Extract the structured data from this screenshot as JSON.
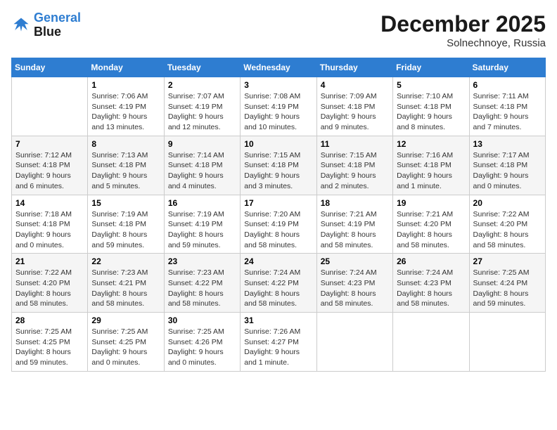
{
  "header": {
    "logo_line1": "General",
    "logo_line2": "Blue",
    "month": "December 2025",
    "location": "Solnechnoye, Russia"
  },
  "weekdays": [
    "Sunday",
    "Monday",
    "Tuesday",
    "Wednesday",
    "Thursday",
    "Friday",
    "Saturday"
  ],
  "weeks": [
    [
      {
        "day": "",
        "info": ""
      },
      {
        "day": "1",
        "info": "Sunrise: 7:06 AM\nSunset: 4:19 PM\nDaylight: 9 hours\nand 13 minutes."
      },
      {
        "day": "2",
        "info": "Sunrise: 7:07 AM\nSunset: 4:19 PM\nDaylight: 9 hours\nand 12 minutes."
      },
      {
        "day": "3",
        "info": "Sunrise: 7:08 AM\nSunset: 4:19 PM\nDaylight: 9 hours\nand 10 minutes."
      },
      {
        "day": "4",
        "info": "Sunrise: 7:09 AM\nSunset: 4:18 PM\nDaylight: 9 hours\nand 9 minutes."
      },
      {
        "day": "5",
        "info": "Sunrise: 7:10 AM\nSunset: 4:18 PM\nDaylight: 9 hours\nand 8 minutes."
      },
      {
        "day": "6",
        "info": "Sunrise: 7:11 AM\nSunset: 4:18 PM\nDaylight: 9 hours\nand 7 minutes."
      }
    ],
    [
      {
        "day": "7",
        "info": "Sunrise: 7:12 AM\nSunset: 4:18 PM\nDaylight: 9 hours\nand 6 minutes."
      },
      {
        "day": "8",
        "info": "Sunrise: 7:13 AM\nSunset: 4:18 PM\nDaylight: 9 hours\nand 5 minutes."
      },
      {
        "day": "9",
        "info": "Sunrise: 7:14 AM\nSunset: 4:18 PM\nDaylight: 9 hours\nand 4 minutes."
      },
      {
        "day": "10",
        "info": "Sunrise: 7:15 AM\nSunset: 4:18 PM\nDaylight: 9 hours\nand 3 minutes."
      },
      {
        "day": "11",
        "info": "Sunrise: 7:15 AM\nSunset: 4:18 PM\nDaylight: 9 hours\nand 2 minutes."
      },
      {
        "day": "12",
        "info": "Sunrise: 7:16 AM\nSunset: 4:18 PM\nDaylight: 9 hours\nand 1 minute."
      },
      {
        "day": "13",
        "info": "Sunrise: 7:17 AM\nSunset: 4:18 PM\nDaylight: 9 hours\nand 0 minutes."
      }
    ],
    [
      {
        "day": "14",
        "info": "Sunrise: 7:18 AM\nSunset: 4:18 PM\nDaylight: 9 hours\nand 0 minutes."
      },
      {
        "day": "15",
        "info": "Sunrise: 7:19 AM\nSunset: 4:18 PM\nDaylight: 8 hours\nand 59 minutes."
      },
      {
        "day": "16",
        "info": "Sunrise: 7:19 AM\nSunset: 4:19 PM\nDaylight: 8 hours\nand 59 minutes."
      },
      {
        "day": "17",
        "info": "Sunrise: 7:20 AM\nSunset: 4:19 PM\nDaylight: 8 hours\nand 58 minutes."
      },
      {
        "day": "18",
        "info": "Sunrise: 7:21 AM\nSunset: 4:19 PM\nDaylight: 8 hours\nand 58 minutes."
      },
      {
        "day": "19",
        "info": "Sunrise: 7:21 AM\nSunset: 4:20 PM\nDaylight: 8 hours\nand 58 minutes."
      },
      {
        "day": "20",
        "info": "Sunrise: 7:22 AM\nSunset: 4:20 PM\nDaylight: 8 hours\nand 58 minutes."
      }
    ],
    [
      {
        "day": "21",
        "info": "Sunrise: 7:22 AM\nSunset: 4:20 PM\nDaylight: 8 hours\nand 58 minutes."
      },
      {
        "day": "22",
        "info": "Sunrise: 7:23 AM\nSunset: 4:21 PM\nDaylight: 8 hours\nand 58 minutes."
      },
      {
        "day": "23",
        "info": "Sunrise: 7:23 AM\nSunset: 4:22 PM\nDaylight: 8 hours\nand 58 minutes."
      },
      {
        "day": "24",
        "info": "Sunrise: 7:24 AM\nSunset: 4:22 PM\nDaylight: 8 hours\nand 58 minutes."
      },
      {
        "day": "25",
        "info": "Sunrise: 7:24 AM\nSunset: 4:23 PM\nDaylight: 8 hours\nand 58 minutes."
      },
      {
        "day": "26",
        "info": "Sunrise: 7:24 AM\nSunset: 4:23 PM\nDaylight: 8 hours\nand 58 minutes."
      },
      {
        "day": "27",
        "info": "Sunrise: 7:25 AM\nSunset: 4:24 PM\nDaylight: 8 hours\nand 59 minutes."
      }
    ],
    [
      {
        "day": "28",
        "info": "Sunrise: 7:25 AM\nSunset: 4:25 PM\nDaylight: 8 hours\nand 59 minutes."
      },
      {
        "day": "29",
        "info": "Sunrise: 7:25 AM\nSunset: 4:25 PM\nDaylight: 9 hours\nand 0 minutes."
      },
      {
        "day": "30",
        "info": "Sunrise: 7:25 AM\nSunset: 4:26 PM\nDaylight: 9 hours\nand 0 minutes."
      },
      {
        "day": "31",
        "info": "Sunrise: 7:26 AM\nSunset: 4:27 PM\nDaylight: 9 hours\nand 1 minute."
      },
      {
        "day": "",
        "info": ""
      },
      {
        "day": "",
        "info": ""
      },
      {
        "day": "",
        "info": ""
      }
    ]
  ]
}
